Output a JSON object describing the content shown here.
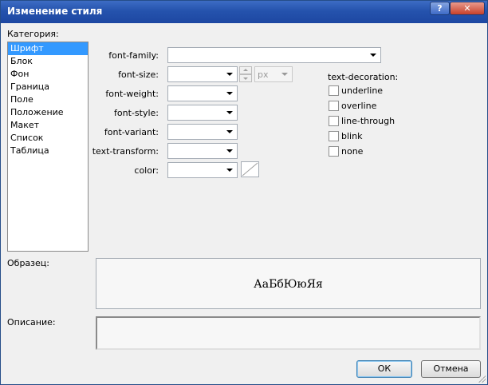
{
  "window": {
    "title": "Изменение стиля",
    "help_label": "?",
    "close_label": "✕"
  },
  "category": {
    "label": "Категория:",
    "items": [
      {
        "label": "Шрифт",
        "selected": true
      },
      {
        "label": "Блок"
      },
      {
        "label": "Фон"
      },
      {
        "label": "Граница"
      },
      {
        "label": "Поле"
      },
      {
        "label": "Положение"
      },
      {
        "label": "Макет"
      },
      {
        "label": "Список"
      },
      {
        "label": "Таблица"
      }
    ]
  },
  "font": {
    "family_label": "font-family:",
    "family_value": "",
    "size_label": "font-size:",
    "size_value": "",
    "size_unit": "px",
    "weight_label": "font-weight:",
    "weight_value": "",
    "style_label": "font-style:",
    "style_value": "",
    "variant_label": "font-variant:",
    "variant_value": "",
    "transform_label": "text-transform:",
    "transform_value": "",
    "color_label": "color:",
    "color_value": ""
  },
  "decoration": {
    "label": "text-decoration:",
    "options": [
      {
        "label": "underline",
        "checked": false
      },
      {
        "label": "overline",
        "checked": false
      },
      {
        "label": "line-through",
        "checked": false
      },
      {
        "label": "blink",
        "checked": false
      },
      {
        "label": "none",
        "checked": false
      }
    ]
  },
  "preview": {
    "label": "Образец:",
    "text": "АаБбЮюЯя"
  },
  "description": {
    "label": "Описание:",
    "text": ""
  },
  "buttons": {
    "ok": "ОК",
    "cancel": "Отмена"
  }
}
